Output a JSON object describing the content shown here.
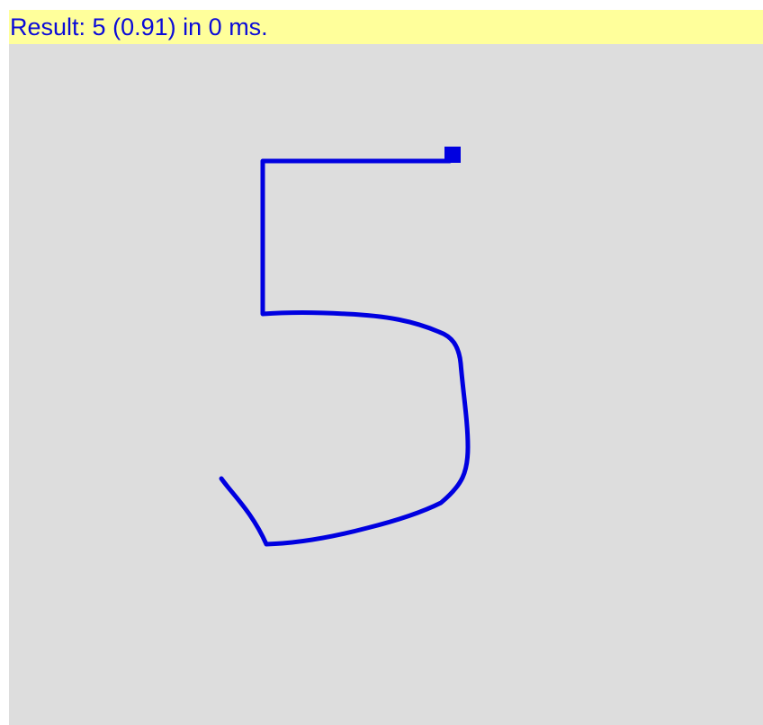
{
  "result": {
    "prefix": "Result: ",
    "digit": "5",
    "confidence": "(0.91)",
    "timing": "in 0 ms."
  },
  "colors": {
    "result_bar_bg": "#ffff9b",
    "result_text": "#0b0bd8",
    "canvas_bg": "#dddddd",
    "stroke": "#0000e0"
  },
  "drawing": {
    "stroke_name": "digit-five-stroke",
    "end_marker": "square-cursor-icon"
  }
}
